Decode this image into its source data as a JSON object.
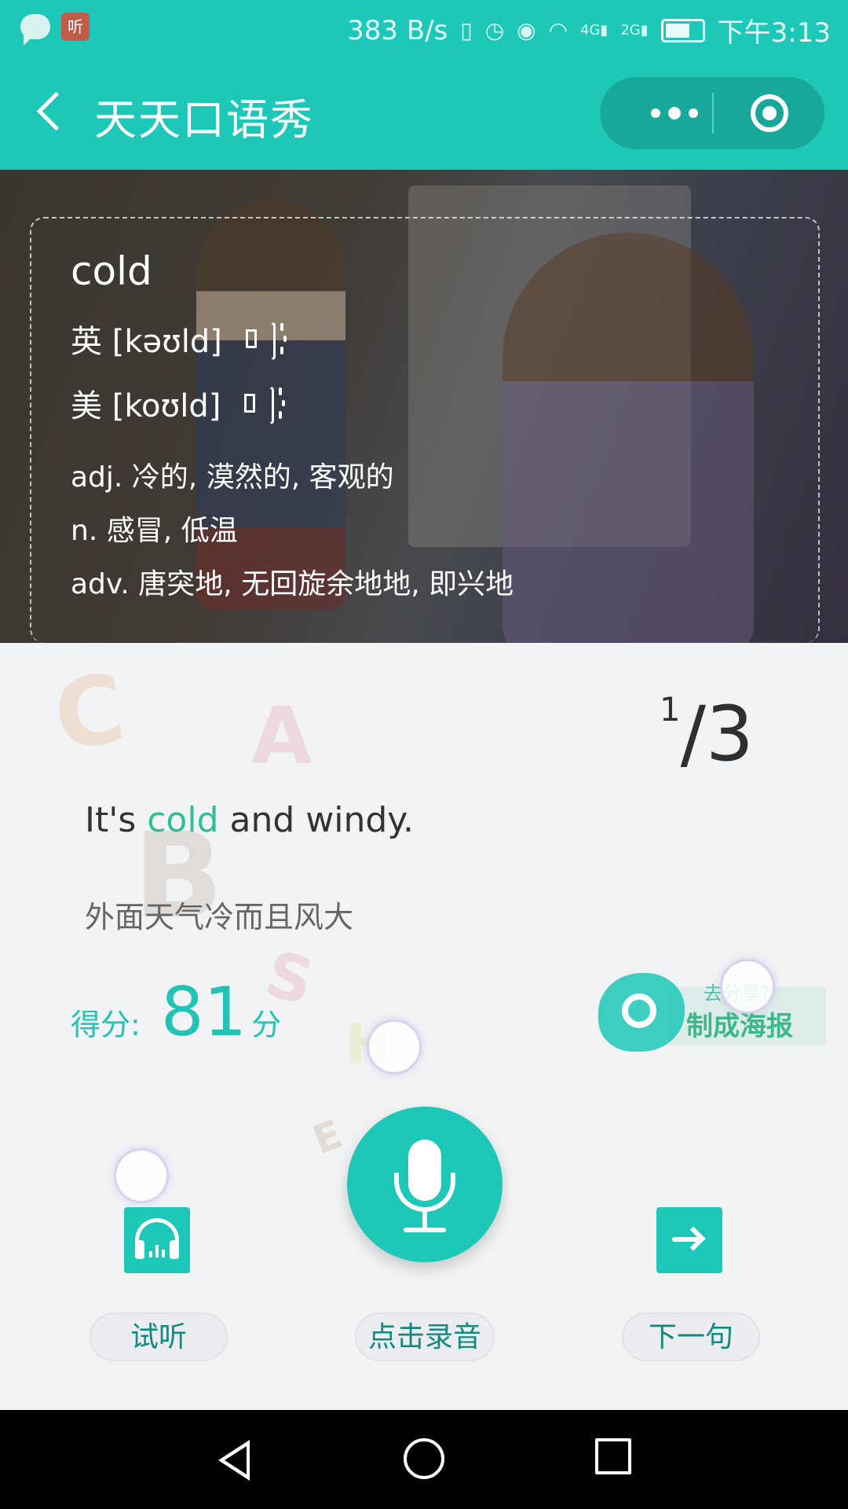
{
  "status_bar": {
    "speed": "383 B/s",
    "app_icon_text": "听",
    "network_4g": "4G",
    "network_2g": "2G",
    "time": "下午3:13",
    "battery_fill": 0.6
  },
  "app_bar": {
    "title": "天天口语秀"
  },
  "word_card": {
    "word": "cold",
    "uk_phonetic": "英 [kəʊld]",
    "us_phonetic": "美 [koʊld]",
    "definitions": [
      "adj. 冷的, 漠然的, 客观的",
      "n. 感冒, 低温",
      "adv. 唐突地, 无回旋余地地, 即兴地"
    ]
  },
  "practice": {
    "current": "1",
    "total": "3",
    "sentence_before": "It's ",
    "sentence_highlight": "cold",
    "sentence_after": " and windy.",
    "translation": "外面天气冷而且风大",
    "score_label": "得分:",
    "score_value": "81",
    "score_unit": "分",
    "share_prompt": "去分享?",
    "share_button": "制成海报"
  },
  "decorations": [
    "C",
    "A",
    "B",
    "S",
    "H",
    "E"
  ],
  "controls": {
    "listen_label": "试听",
    "record_label": "点击录音",
    "next_label": "下一句"
  },
  "colors": {
    "accent": "#1ec8b8",
    "highlight": "#2fbf94",
    "button_text": "#138a80"
  }
}
